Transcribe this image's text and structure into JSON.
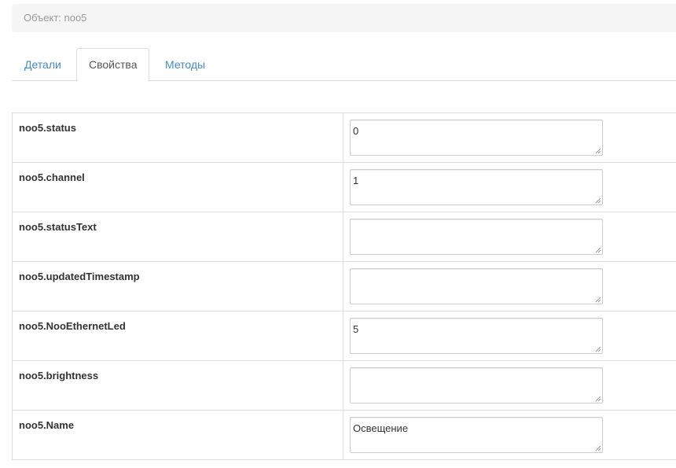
{
  "breadcrumb": {
    "text": "Объект: noo5"
  },
  "tabs": [
    {
      "label": "Детали",
      "active": false
    },
    {
      "label": "Свойства",
      "active": true
    },
    {
      "label": "Методы",
      "active": false
    }
  ],
  "properties": [
    {
      "name": "noo5.status",
      "value": "0"
    },
    {
      "name": "noo5.channel",
      "value": "1"
    },
    {
      "name": "noo5.statusText",
      "value": ""
    },
    {
      "name": "noo5.updatedTimestamp",
      "value": ""
    },
    {
      "name": "noo5.NooEthernetLed",
      "value": "5"
    },
    {
      "name": "noo5.brightness",
      "value": ""
    },
    {
      "name": "noo5.Name",
      "value": "Освещение"
    }
  ],
  "colors": {
    "link": "#428bca",
    "border": "#dddddd",
    "breadcrumb_bg": "#f5f5f5"
  },
  "icons": {
    "resize": "resize-grip-icon"
  }
}
